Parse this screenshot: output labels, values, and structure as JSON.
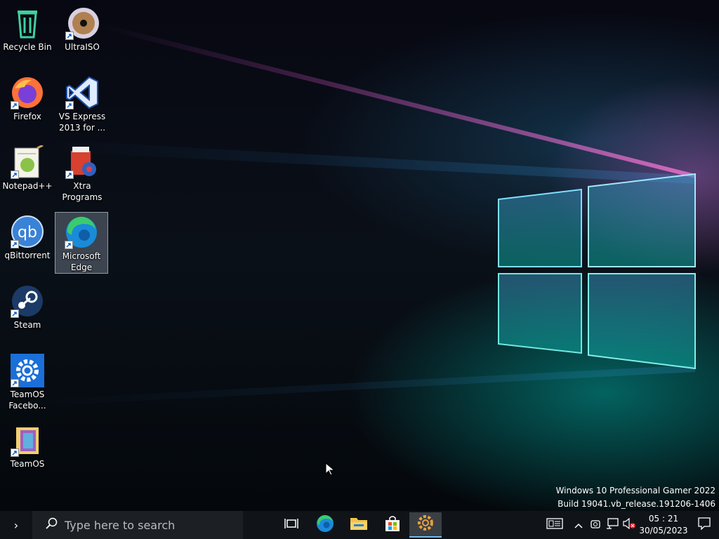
{
  "desktop": {
    "icons": [
      {
        "label": "Recycle Bin",
        "icon": "recycle-bin-icon"
      },
      {
        "label": "UltraISO",
        "icon": "ultraiso-icon"
      },
      {
        "label": "Firefox",
        "icon": "firefox-icon"
      },
      {
        "label": "VS Express\n2013 for ...",
        "icon": "visual-studio-icon"
      },
      {
        "label": "Notepad++",
        "icon": "notepad-plus-plus-icon"
      },
      {
        "label": "Xtra\nPrograms",
        "icon": "xtra-programs-icon"
      },
      {
        "label": "qBittorrent",
        "icon": "qbittorrent-icon"
      },
      {
        "label": "Microsoft\nEdge",
        "icon": "edge-icon",
        "selected": true
      },
      {
        "label": "Steam",
        "icon": "steam-icon"
      },
      {
        "label": "TeamOS\nFacebo...",
        "icon": "settings-gear-icon"
      },
      {
        "label": "TeamOS",
        "icon": "teamos-folder-icon"
      }
    ],
    "watermark": {
      "line1": "Windows 10 Professional Gamer 2022",
      "line2": "Build 19041.vb_release.191206-1406"
    }
  },
  "taskbar": {
    "start_glyph": "›",
    "search": {
      "placeholder": "Type here to search",
      "icon": "search-icon"
    },
    "apps": [
      {
        "name": "Task View",
        "icon": "task-view-icon"
      },
      {
        "name": "Microsoft Edge",
        "icon": "edge-icon"
      },
      {
        "name": "File Explorer",
        "icon": "folder-icon"
      },
      {
        "name": "Microsoft Store",
        "icon": "store-icon"
      },
      {
        "name": "Settings",
        "icon": "settings-gear-icon",
        "active": true
      }
    ],
    "tray": {
      "icons": [
        "news-icon",
        "chevron-up-icon",
        "camera-icon",
        "network-icon",
        "volume-muted-icon",
        "notification-icon"
      ],
      "time": "05 : 21",
      "date": "30/05/2023"
    }
  },
  "colors": {
    "taskbar_bg": "#101418",
    "search_bg": "#1c2024",
    "accent": "#76b9ed",
    "edge_blue": "#1a8bd8",
    "edge_green": "#3bcb6e",
    "steam_blue": "#1b3a66",
    "firefox_orange": "#ff7139",
    "vs_blue": "#1f4fa8"
  }
}
